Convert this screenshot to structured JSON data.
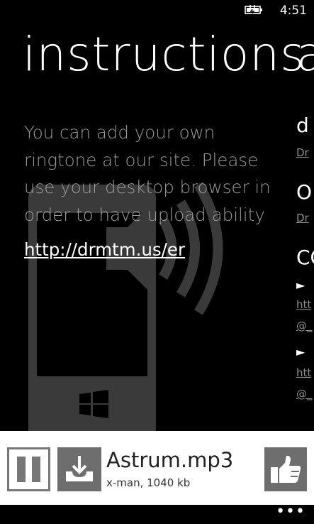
{
  "status_bar": {
    "time": "4:51",
    "battery_icon": "battery-charging-icon"
  },
  "pivot": {
    "title": "instructions",
    "next_title_peek": "a"
  },
  "instructions": {
    "text": "You can add your own ringtone at our site. Please use your desktop browser in order to have upload ability",
    "link": "http://drmtm.us/er"
  },
  "peek_column": {
    "items": [
      "d",
      "Dr",
      "O",
      "Dr",
      "CO",
      "►",
      "htt",
      "@_",
      "►",
      "htt",
      "@_"
    ]
  },
  "player": {
    "track_name": "Astrum.mp3",
    "track_meta": "x-man,  1040 kb",
    "pause_icon": "pause-icon",
    "download_icon": "download-icon",
    "like_icon": "thumbs-up-icon"
  },
  "app_bar": {
    "more": "•••"
  },
  "colors": {
    "background": "#000000",
    "text_dim": "#9a9a9a",
    "player_bg": "#ffffff",
    "button_gray": "#6e6e6e"
  }
}
